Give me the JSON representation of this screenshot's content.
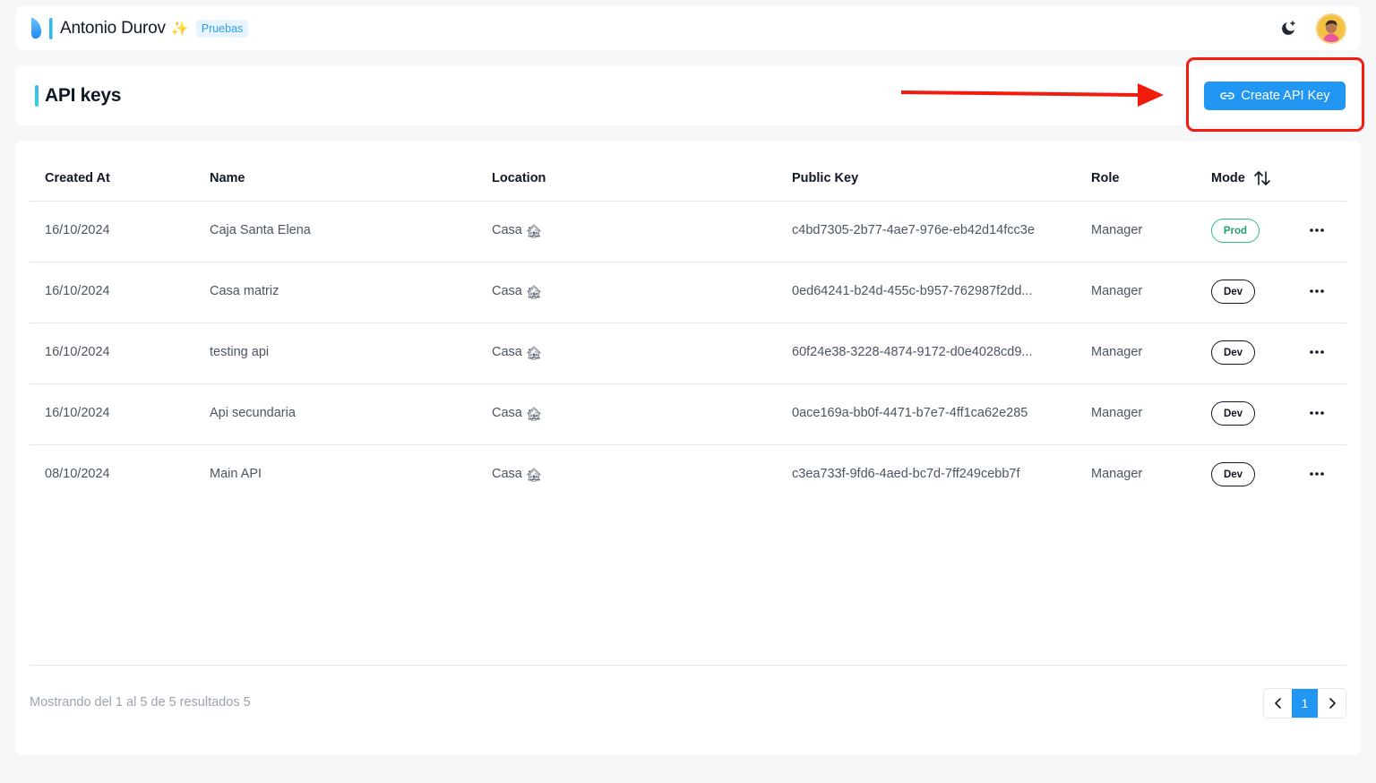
{
  "header": {
    "user_name": "Antonio Durov",
    "sparkle_icon": "sparkles-icon",
    "env_badge": "Pruebas",
    "theme_icon": "moon-plus-icon",
    "avatar_icon": "user-avatar"
  },
  "page": {
    "title": "API keys",
    "create_button_label": "Create API Key",
    "create_button_icon": "link-icon"
  },
  "table": {
    "columns": {
      "created_at": "Created At",
      "name": "Name",
      "location": "Location",
      "public_key": "Public Key",
      "role": "Role",
      "mode": "Mode"
    },
    "rows": [
      {
        "created_at": "16/10/2024",
        "name": "Caja Santa Elena",
        "location": "Casa",
        "public_key": "c4bd7305-2b77-4ae7-976e-eb42d14fcc3e",
        "role": "Manager",
        "mode": "Prod"
      },
      {
        "created_at": "16/10/2024",
        "name": "Casa matriz",
        "location": "Casa",
        "public_key": "0ed64241-b24d-455c-b957-762987f2dd...",
        "role": "Manager",
        "mode": "Dev"
      },
      {
        "created_at": "16/10/2024",
        "name": "testing api",
        "location": "Casa",
        "public_key": "60f24e38-3228-4874-9172-d0e4028cd9...",
        "role": "Manager",
        "mode": "Dev"
      },
      {
        "created_at": "16/10/2024",
        "name": "Api secundaria",
        "location": "Casa",
        "public_key": "0ace169a-bb0f-4471-b7e7-4ff1ca62e285",
        "role": "Manager",
        "mode": "Dev"
      },
      {
        "created_at": "08/10/2024",
        "name": "Main API",
        "location": "Casa",
        "public_key": "c3ea733f-9fd6-4aed-bc7d-7ff249cebb7f",
        "role": "Manager",
        "mode": "Dev"
      }
    ]
  },
  "footer": {
    "results_text": "Mostrando del 1 al 5 de 5 resultados 5",
    "current_page": "1"
  },
  "colors": {
    "primary": "#2196f3",
    "prod_badge": "#22a06b",
    "annotation": "#f21b0c"
  }
}
